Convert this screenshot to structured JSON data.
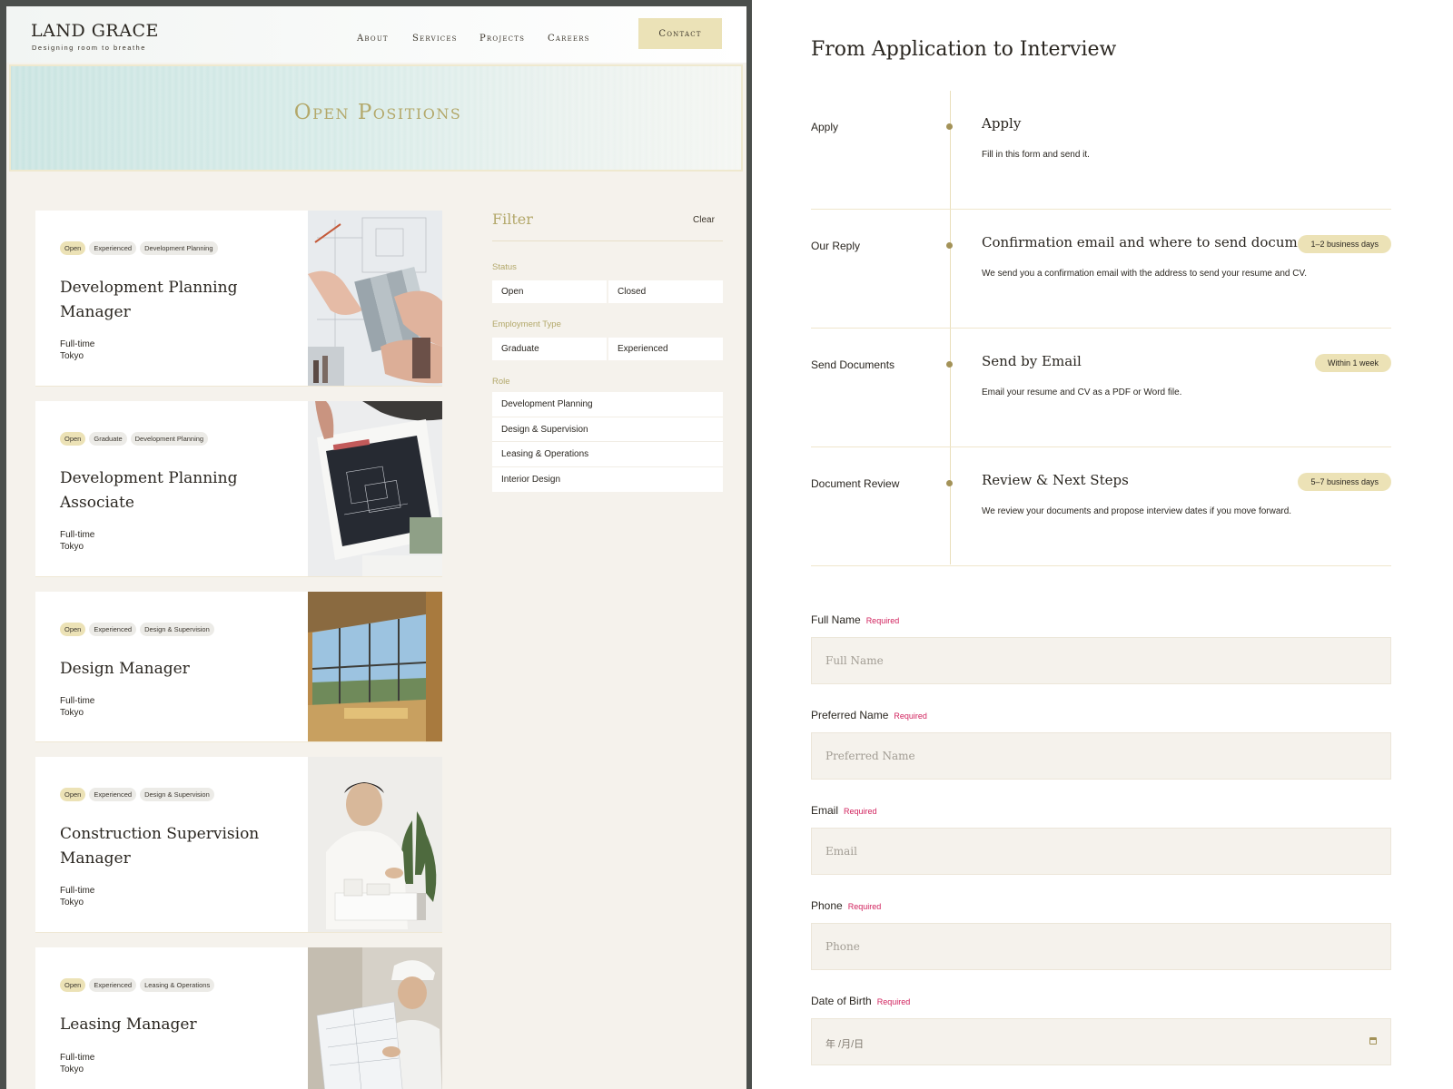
{
  "header": {
    "logo": "LAND GRACE",
    "tagline": "Designing room to breathe",
    "nav": [
      "About",
      "Services",
      "Projects",
      "Careers"
    ],
    "contact_label": "Contact"
  },
  "hero": {
    "title": "Open Positions"
  },
  "jobs": [
    {
      "tags": [
        "Open",
        "Experienced",
        "Development Planning"
      ],
      "title": "Development Planning Manager",
      "type": "Full-time",
      "location": "Tokyo",
      "photo": "swatch-photo"
    },
    {
      "tags": [
        "Open",
        "Graduate",
        "Development Planning"
      ],
      "title": "Development Planning Associate",
      "type": "Full-time",
      "location": "Tokyo",
      "photo": "blueprint-photo"
    },
    {
      "tags": [
        "Open",
        "Experienced",
        "Design & Supervision"
      ],
      "title": "Design Manager",
      "type": "Full-time",
      "location": "Tokyo",
      "photo": "window-photo"
    },
    {
      "tags": [
        "Open",
        "Experienced",
        "Design & Supervision"
      ],
      "title": "Construction Supervision Manager",
      "type": "Full-time",
      "location": "Tokyo",
      "photo": "architect-photo"
    },
    {
      "tags": [
        "Open",
        "Experienced",
        "Leasing & Operations"
      ],
      "title": "Leasing Manager",
      "type": "Full-time",
      "location": "Tokyo",
      "photo": "hardhat-photo"
    }
  ],
  "filter": {
    "title": "Filter",
    "clear_label": "Clear",
    "status_label": "Status",
    "status_options": [
      "Open",
      "Closed"
    ],
    "employment_label": "Employment Type",
    "employment_options": [
      "Graduate",
      "Experienced"
    ],
    "role_label": "Role",
    "role_options": [
      "Development Planning",
      "Design & Supervision",
      "Leasing & Operations",
      "Interior Design"
    ]
  },
  "process": {
    "title": "From Application to Interview",
    "steps": [
      {
        "label": "Apply",
        "heading": "Apply",
        "description": "Fill in this form and send it.",
        "badge": ""
      },
      {
        "label": "Our Reply",
        "heading": "Confirmation email and where to send documents",
        "description": "We send you a confirmation email with the address to send your resume and CV.",
        "badge": "1–2 business days"
      },
      {
        "label": "Send Documents",
        "heading": "Send by Email",
        "description": "Email your resume and CV as a PDF or Word file.",
        "badge": "Within 1 week"
      },
      {
        "label": "Document Review",
        "heading": "Review & Next Steps",
        "description": "We review your documents and propose interview dates if you move forward.",
        "badge": "5–7 business days"
      }
    ]
  },
  "form": {
    "required_label": "Required",
    "full_name": {
      "label": "Full Name",
      "placeholder": "Full Name"
    },
    "preferred_name": {
      "label": "Preferred Name",
      "placeholder": "Preferred Name"
    },
    "email": {
      "label": "Email",
      "placeholder": "Email"
    },
    "phone": {
      "label": "Phone",
      "placeholder": "Phone"
    },
    "dob": {
      "label": "Date of Birth",
      "placeholder": "年 /月/日"
    }
  },
  "colors": {
    "accent": "#b3a86a",
    "badge": "#ece2b6",
    "required": "#d1235e",
    "panel_bg": "#f5f2ec"
  }
}
